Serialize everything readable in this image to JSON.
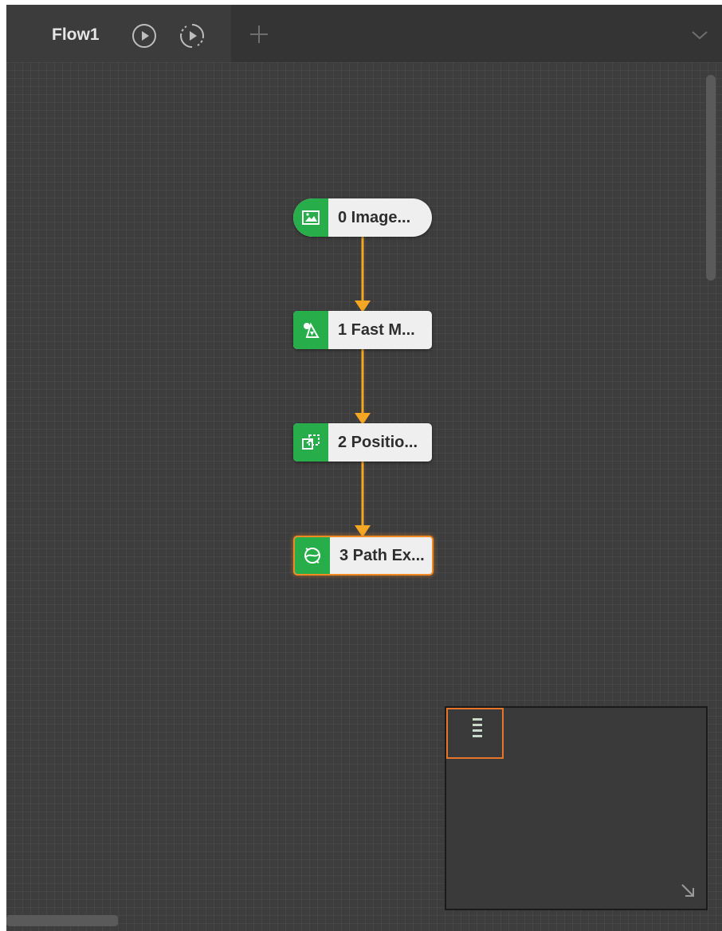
{
  "flow_tab": {
    "title": "Flow1",
    "run_once_icon": "play-circle-icon",
    "run_loop_icon": "loop-play-icon",
    "add_tab_icon": "plus-icon",
    "collapse_icon": "chevron-down-icon"
  },
  "nodes": [
    {
      "label": "0 Image...",
      "icon": "image-icon",
      "shape": "pill"
    },
    {
      "label": "1 Fast M...",
      "icon": "shape-match-icon",
      "shape": "rect"
    },
    {
      "label": "2 Positio...",
      "icon": "position-correction-icon",
      "shape": "rect"
    },
    {
      "label": "3 Path Ex...",
      "icon": "path-extract-icon",
      "shape": "rect",
      "selected": true
    }
  ],
  "colors": {
    "canvas_bg": "#3d3d3d",
    "connector": "#f5a623",
    "node_icon_bg": "#27ae4a",
    "selection": "#f08a24"
  },
  "minimap": {
    "resize_icon": "resize-arrow-icon"
  }
}
